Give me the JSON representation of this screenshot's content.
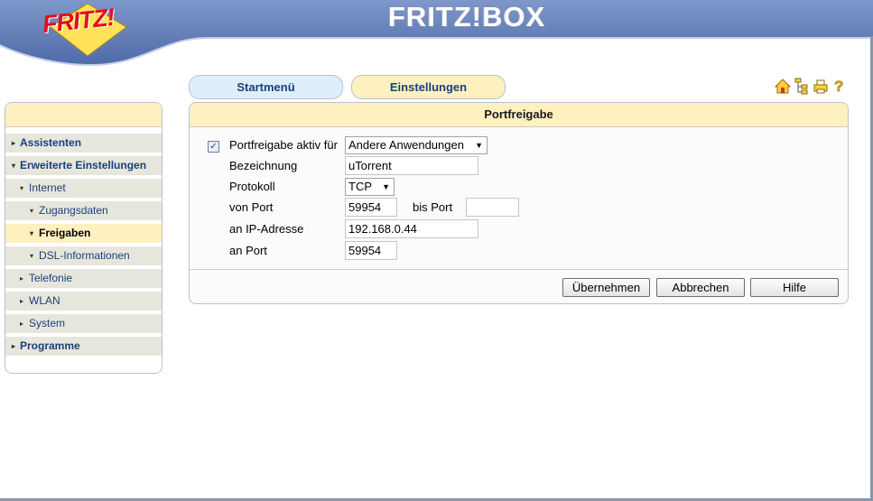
{
  "header": {
    "brand_title": "FRITZ!BOX",
    "logo_text": "FRITZ!",
    "colors": {
      "banner_blue": "#5b78b8",
      "banner_light": "#e8eef8",
      "logo_red": "#e0101a",
      "logo_yellow": "#ffe25a"
    }
  },
  "tabs": [
    {
      "label": "Startmenü"
    },
    {
      "label": "Einstellungen"
    }
  ],
  "toolbar_icons": [
    "home-icon",
    "sitemap-icon",
    "print-icon",
    "help-icon"
  ],
  "sidebar": {
    "items": [
      {
        "label": "Assistenten",
        "arrow": "▸",
        "level": 0
      },
      {
        "label": "Erweiterte Einstellungen",
        "arrow": "▾",
        "level": 0
      },
      {
        "label": "Internet",
        "arrow": "▾",
        "level": 1
      },
      {
        "label": "Zugangsdaten",
        "arrow": "▾",
        "level": 2
      },
      {
        "label": "Freigaben",
        "arrow": "▾",
        "level": 2,
        "active": true
      },
      {
        "label": "DSL-Informationen",
        "arrow": "▾",
        "level": 2
      },
      {
        "label": "Telefonie",
        "arrow": "▸",
        "level": 1
      },
      {
        "label": "WLAN",
        "arrow": "▸",
        "level": 1
      },
      {
        "label": "System",
        "arrow": "▸",
        "level": 1
      },
      {
        "label": "Programme",
        "arrow": "▸",
        "level": 0
      }
    ]
  },
  "panel": {
    "title": "Portfreigabe",
    "form": {
      "portfreigabe_label": "Portfreigabe aktiv für",
      "portfreigabe_checked": true,
      "portfreigabe_select": "Andere Anwendungen",
      "bezeichnung_label": "Bezeichnung",
      "bezeichnung_value": "uTorrent",
      "protokoll_label": "Protokoll",
      "protokoll_value": "TCP",
      "von_port_label": "von Port",
      "von_port_value": "59954",
      "bis_port_label": "bis Port",
      "bis_port_value": "",
      "ip_label": "an IP-Adresse",
      "ip_value": "192.168.0.44",
      "an_port_label": "an Port",
      "an_port_value": "59954"
    },
    "buttons": {
      "apply": "Übernehmen",
      "cancel": "Abbrechen",
      "help": "Hilfe"
    }
  }
}
